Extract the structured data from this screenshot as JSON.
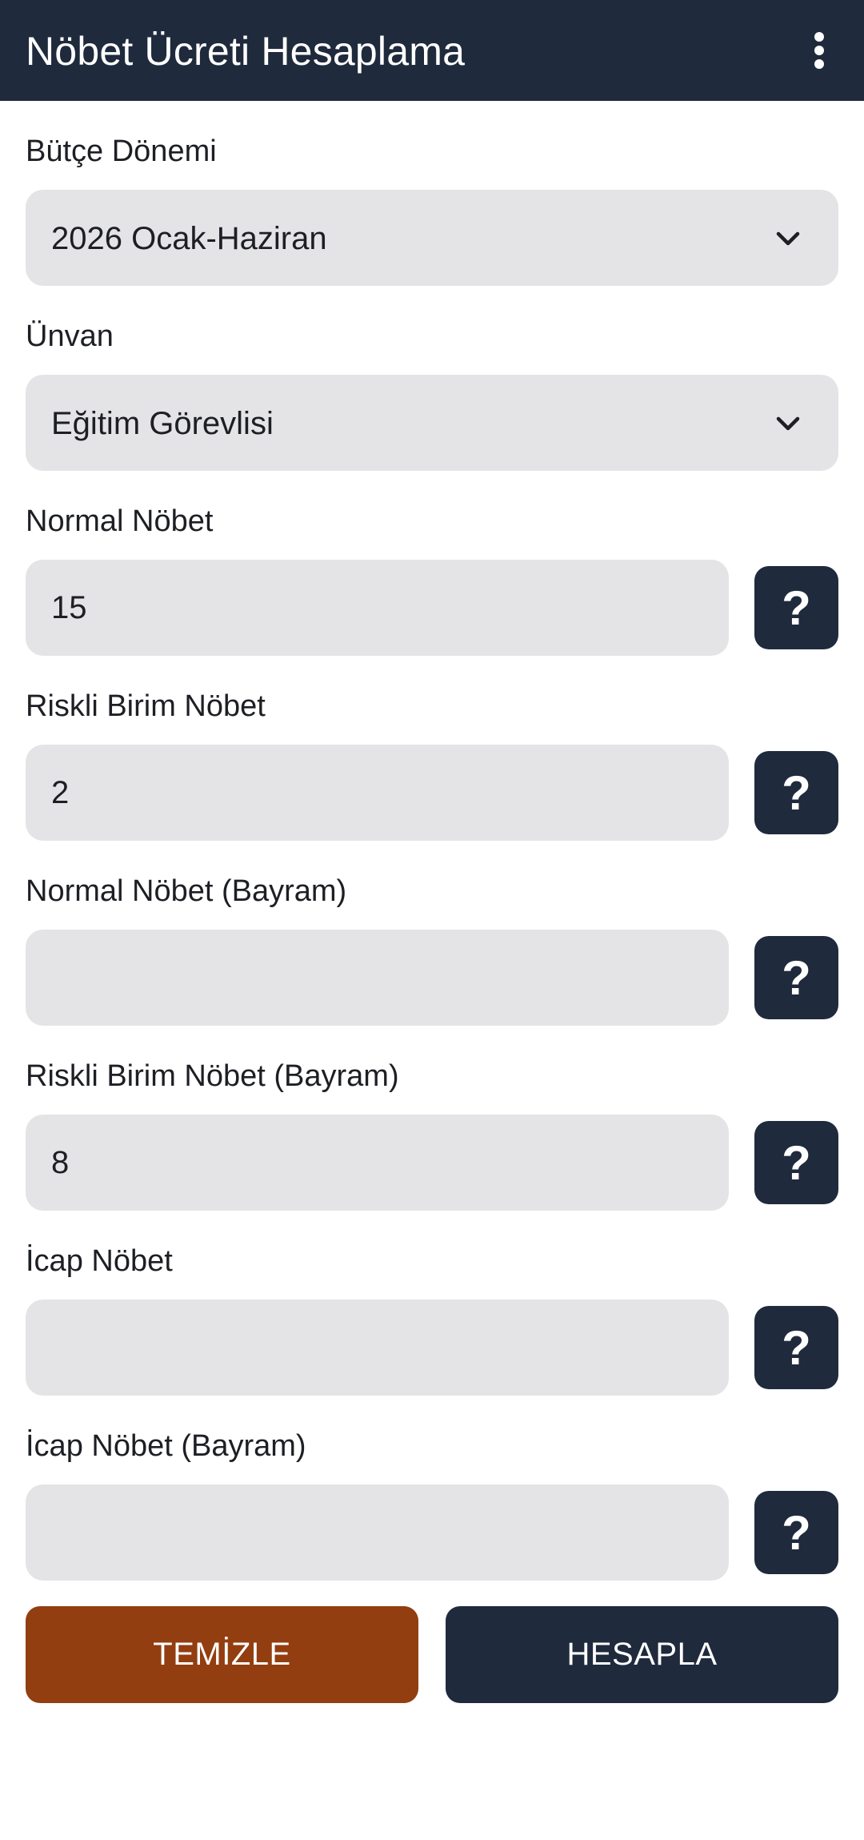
{
  "appbar": {
    "title": "Nöbet Ücreti Hesaplama",
    "menu_icon": "more-vertical-icon"
  },
  "colors": {
    "appbar_bg": "#1f2a3c",
    "field_bg": "#e4e4e6",
    "help_button_bg": "#1f2a3c",
    "clear_button_bg": "#923e10",
    "calculate_button_bg": "#1f2a3c"
  },
  "budget_period": {
    "label": "Bütçe Dönemi",
    "selected": "2026 Ocak-Haziran"
  },
  "title_field": {
    "label": "Ünvan",
    "selected": "Eğitim Görevlisi"
  },
  "fields": [
    {
      "label": "Normal Nöbet",
      "value": "15",
      "help": "?"
    },
    {
      "label": "Riskli Birim Nöbet",
      "value": "2",
      "help": "?"
    },
    {
      "label": "Normal Nöbet (Bayram)",
      "value": "",
      "help": "?"
    },
    {
      "label": "Riskli Birim Nöbet (Bayram)",
      "value": "8",
      "help": "?"
    },
    {
      "label": "İcap Nöbet",
      "value": "",
      "help": "?"
    },
    {
      "label": "İcap Nöbet (Bayram)",
      "value": "",
      "help": "?"
    }
  ],
  "actions": {
    "clear_label": "TEMİZLE",
    "calculate_label": "HESAPLA"
  }
}
